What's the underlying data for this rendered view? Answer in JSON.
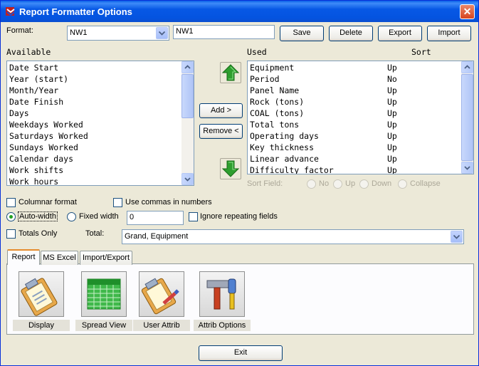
{
  "window": {
    "title": "Report Formatter Options",
    "close_glyph": "✕"
  },
  "format": {
    "label": "Format:",
    "selected": "NW1",
    "name_value": "NW1",
    "buttons": {
      "save": "Save",
      "delete": "Delete",
      "export": "Export",
      "import": "Import"
    }
  },
  "available": {
    "header": "Available",
    "items": [
      "Date Start",
      "Year (start)",
      "Month/Year",
      "Date Finish",
      "Days",
      "Weekdays Worked",
      "Saturdays Worked",
      "Sundays Worked",
      "Calendar days",
      "Work shifts",
      "Work hours"
    ]
  },
  "used": {
    "header": "Used",
    "sort_header": "Sort",
    "items": [
      {
        "name": "Equipment",
        "sort": "Up"
      },
      {
        "name": "Period",
        "sort": "No"
      },
      {
        "name": "Panel Name",
        "sort": "Up"
      },
      {
        "name": "Rock (tons)",
        "sort": "Up"
      },
      {
        "name": "COAL (tons)",
        "sort": "Up"
      },
      {
        "name": "Total tons",
        "sort": "Up"
      },
      {
        "name": "Operating days",
        "sort": "Up"
      },
      {
        "name": "Key thickness",
        "sort": "Up"
      },
      {
        "name": "Linear advance",
        "sort": "Up"
      },
      {
        "name": "Difficulty factor",
        "sort": "Up"
      }
    ]
  },
  "middle_buttons": {
    "add": "Add >",
    "remove": "Remove <"
  },
  "sort_field": {
    "label": "Sort Field:",
    "options": [
      "No",
      "Up",
      "Down",
      "Collapse"
    ]
  },
  "options": {
    "columnar": "Columnar format",
    "commas": "Use commas in numbers",
    "auto_width": "Auto-width",
    "fixed_width": "Fixed width",
    "fixed_width_value": "0",
    "ignore_repeating": "Ignore repeating fields",
    "totals_only": "Totals Only",
    "total_label": "Total:",
    "total_value": "Grand, Equipment"
  },
  "tabs": [
    "Report",
    "MS Excel",
    "Import/Export"
  ],
  "tools": [
    {
      "label": "Display",
      "icon": "clipboard-icon"
    },
    {
      "label": "Spread View",
      "icon": "spreadsheet-icon"
    },
    {
      "label": "User Attrib",
      "icon": "clipboard-pencil-icon"
    },
    {
      "label": "Attrib Options",
      "icon": "tools-icon"
    }
  ],
  "exit_label": "Exit",
  "colors": {
    "titlebar": "#0454E0",
    "window_bg": "#ECE9D8",
    "arrow_green": "#2E9E2E"
  }
}
